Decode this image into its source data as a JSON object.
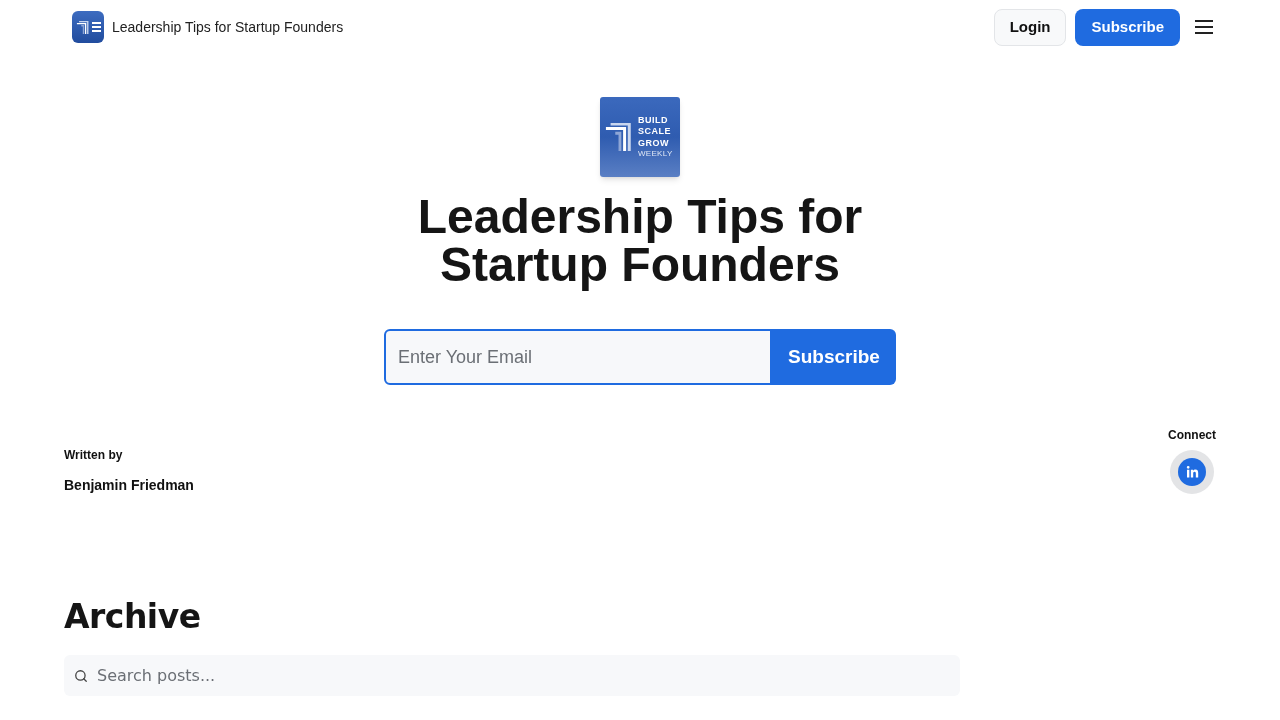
{
  "header": {
    "title": "Leadership Tips for Startup Founders",
    "buttons": [
      {
        "label": "Login",
        "kind": "secondary"
      },
      {
        "label": "Subscribe",
        "kind": "primary"
      }
    ]
  },
  "hero": {
    "logo_lines": [
      {
        "text": "BUILD",
        "kind": "bold"
      },
      {
        "text": "SCALE",
        "kind": "bold"
      },
      {
        "text": "GROW",
        "kind": "bold"
      },
      {
        "text": "WEEKLY",
        "kind": "light"
      }
    ],
    "title": "Leadership Tips for Startup Founders",
    "email": {
      "placeholder": "Enter Your Email"
    },
    "subscribe": "Subscribe"
  },
  "author": {
    "heading": "Written by",
    "name": "Benjamin Friedman"
  },
  "connect": {
    "heading": "Connect"
  },
  "archive": {
    "title": "Archive",
    "search": {
      "placeholder": "Search posts..."
    }
  }
}
